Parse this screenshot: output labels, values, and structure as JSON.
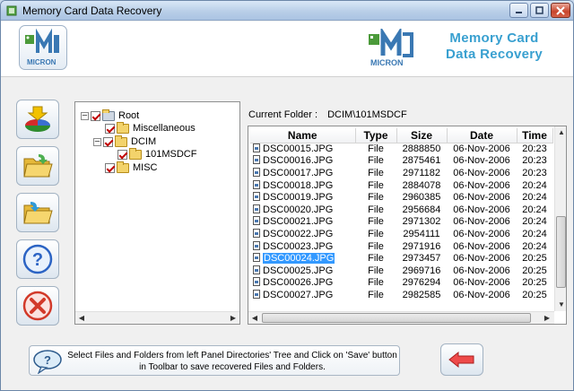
{
  "window": {
    "title": "Memory Card Data Recovery"
  },
  "header": {
    "brand_line1": "Memory Card",
    "brand_line2": "Data Recovery",
    "logo_text": "MICRON"
  },
  "toolbar": {
    "buttons": [
      {
        "name": "recover-drive-button",
        "icon": "drive-pie-icon"
      },
      {
        "name": "open-folder-button",
        "icon": "folder-open-icon"
      },
      {
        "name": "save-button",
        "icon": "folder-save-icon"
      },
      {
        "name": "help-button",
        "icon": "question-icon"
      },
      {
        "name": "exit-button",
        "icon": "close-x-icon"
      }
    ]
  },
  "tree": {
    "items": [
      {
        "label": "Root",
        "level": 0,
        "expander": "−",
        "type": "drive"
      },
      {
        "label": "Miscellaneous",
        "level": 1,
        "expander": "",
        "type": "folder"
      },
      {
        "label": "DCIM",
        "level": 1,
        "expander": "−",
        "type": "folder"
      },
      {
        "label": "101MSDCF",
        "level": 2,
        "expander": "",
        "type": "folder"
      },
      {
        "label": "MISC",
        "level": 1,
        "expander": "",
        "type": "folder"
      }
    ]
  },
  "folder": {
    "label": "Current Folder  :",
    "path": "DCIM\\101MSDCF"
  },
  "files": {
    "columns": [
      "Name",
      "Type",
      "Size",
      "Date",
      "Time"
    ],
    "selected_index": 9,
    "rows": [
      [
        "DSC00015.JPG",
        "File",
        "2888850",
        "06-Nov-2006",
        "20:23"
      ],
      [
        "DSC00016.JPG",
        "File",
        "2875461",
        "06-Nov-2006",
        "20:23"
      ],
      [
        "DSC00017.JPG",
        "File",
        "2971182",
        "06-Nov-2006",
        "20:23"
      ],
      [
        "DSC00018.JPG",
        "File",
        "2884078",
        "06-Nov-2006",
        "20:24"
      ],
      [
        "DSC00019.JPG",
        "File",
        "2960385",
        "06-Nov-2006",
        "20:24"
      ],
      [
        "DSC00020.JPG",
        "File",
        "2956684",
        "06-Nov-2006",
        "20:24"
      ],
      [
        "DSC00021.JPG",
        "File",
        "2971302",
        "06-Nov-2006",
        "20:24"
      ],
      [
        "DSC00022.JPG",
        "File",
        "2954111",
        "06-Nov-2006",
        "20:24"
      ],
      [
        "DSC00023.JPG",
        "File",
        "2971916",
        "06-Nov-2006",
        "20:24"
      ],
      [
        "DSC00024.JPG",
        "File",
        "2973457",
        "06-Nov-2006",
        "20:25"
      ],
      [
        "DSC00025.JPG",
        "File",
        "2969716",
        "06-Nov-2006",
        "20:25"
      ],
      [
        "DSC00026.JPG",
        "File",
        "2976294",
        "06-Nov-2006",
        "20:25"
      ],
      [
        "DSC00027.JPG",
        "File",
        "2982585",
        "06-Nov-2006",
        "20:25"
      ]
    ]
  },
  "status": {
    "message": "Select Files and Folders from left Panel Directories' Tree and Click on 'Save' button in Toolbar to save recovered Files and Folders."
  },
  "colors": {
    "accent": "#39a0d0",
    "selection": "#3399ff",
    "check": "#c00000"
  }
}
